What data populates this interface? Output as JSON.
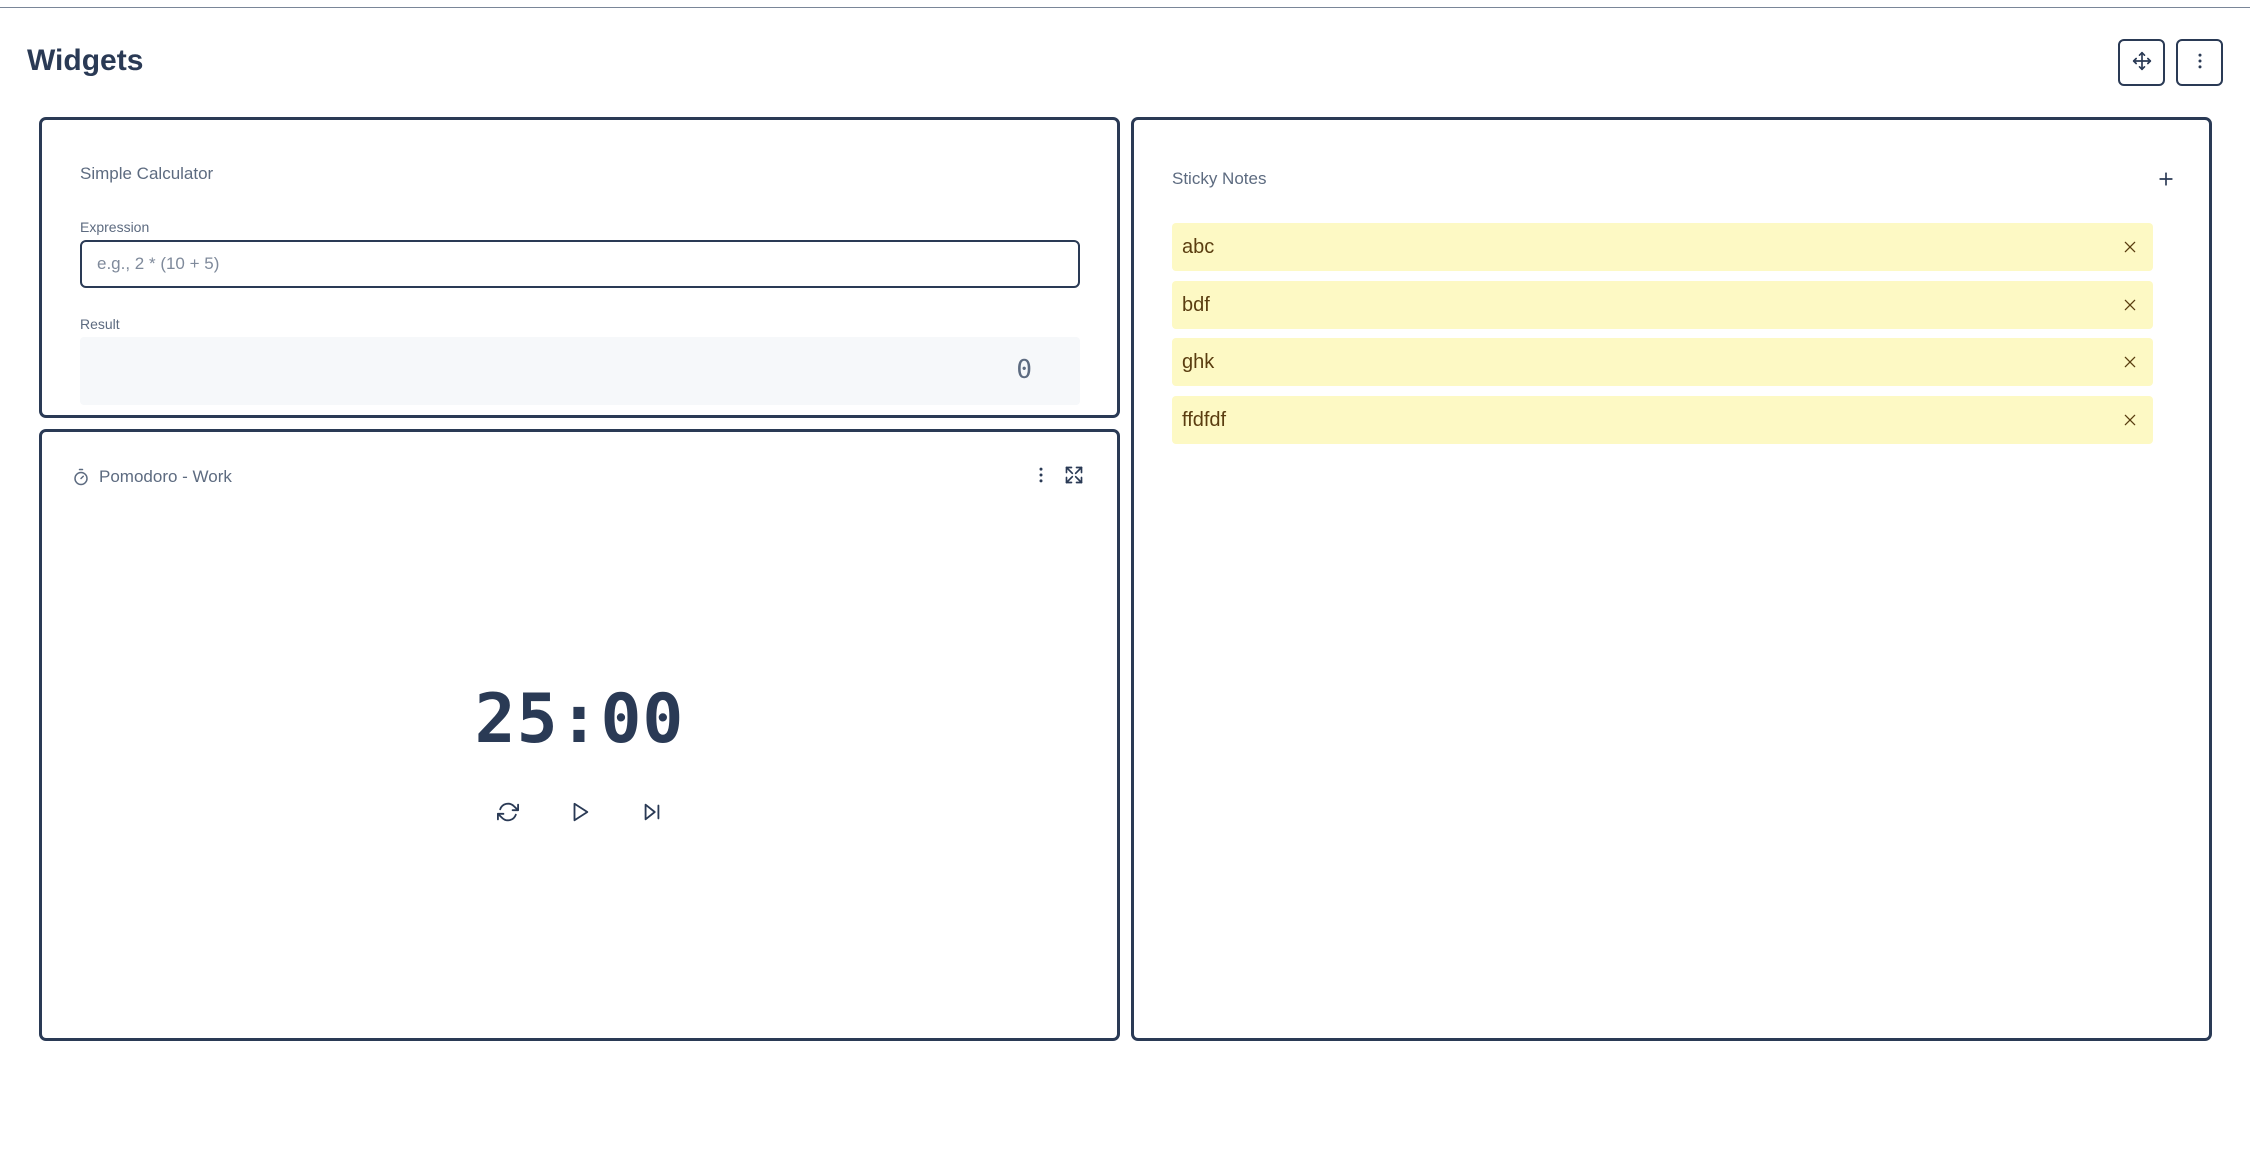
{
  "header": {
    "title": "Widgets",
    "move_icon": "move-icon",
    "more_icon": "more-vertical-icon"
  },
  "calculator": {
    "title": "Simple Calculator",
    "expression_label": "Expression",
    "expression_value": "",
    "expression_placeholder": "e.g., 2 * (10 + 5)",
    "result_label": "Result",
    "result_value": "0"
  },
  "pomodoro": {
    "title": "Pomodoro - Work",
    "timer_icon": "timer-icon",
    "time": "25:00",
    "controls": [
      "reset-icon",
      "play-icon",
      "skip-forward-icon"
    ]
  },
  "sticky_notes": {
    "title": "Sticky Notes",
    "add_icon": "plus-icon",
    "notes": [
      {
        "text": "abc"
      },
      {
        "text": "bdf"
      },
      {
        "text": "ghk"
      },
      {
        "text": "ffdfdf"
      }
    ],
    "note_color": "#fdf9c4"
  },
  "colors": {
    "primary": "#2a3a55",
    "muted": "#5d6b80",
    "note_text": "#5a3d10"
  }
}
